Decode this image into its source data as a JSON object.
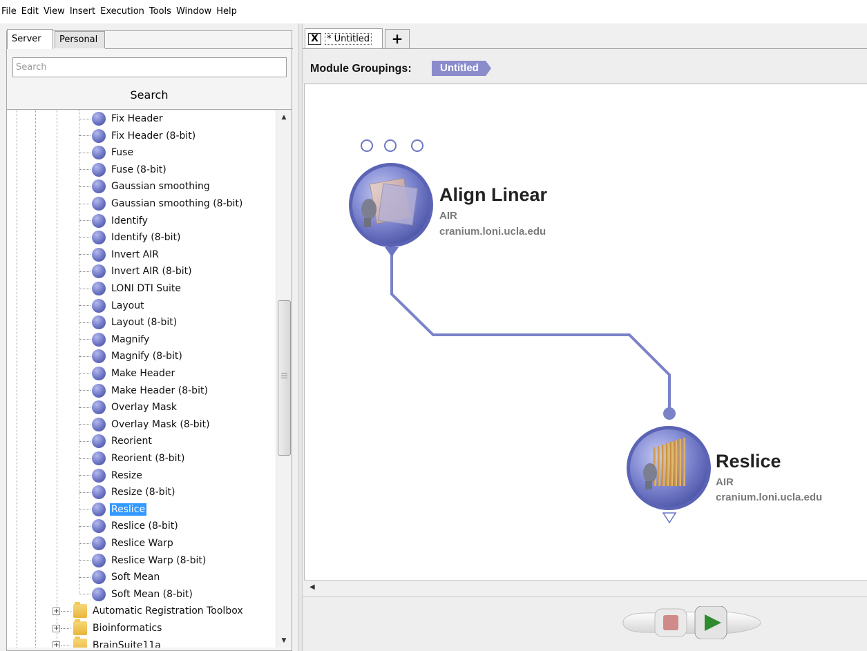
{
  "menu": [
    "File",
    "Edit",
    "View",
    "Insert",
    "Execution",
    "Tools",
    "Window",
    "Help"
  ],
  "left_tabs": {
    "server": "Server",
    "personal": "Personal"
  },
  "search": {
    "placeholder": "Search",
    "button": "Search"
  },
  "tree_items": [
    "Fix Header",
    "Fix Header (8-bit)",
    "Fuse",
    "Fuse (8-bit)",
    "Gaussian smoothing",
    "Gaussian smoothing (8-bit)",
    "Identify",
    "Identify (8-bit)",
    "Invert AIR",
    "Invert AIR (8-bit)",
    "LONI DTI Suite",
    "Layout",
    "Layout (8-bit)",
    "Magnify",
    "Magnify (8-bit)",
    "Make Header",
    "Make Header (8-bit)",
    "Overlay Mask",
    "Overlay Mask (8-bit)",
    "Reorient",
    "Reorient (8-bit)",
    "Resize",
    "Resize (8-bit)",
    "Reslice",
    "Reslice (8-bit)",
    "Reslice Warp",
    "Reslice Warp (8-bit)",
    "Soft Mean",
    "Soft Mean (8-bit)"
  ],
  "selected_item": "Reslice",
  "tree_folders": [
    "Automatic Registration Toolbox",
    "Bioinformatics",
    "BrainSuite11a"
  ],
  "document_tab": {
    "label": "* Untitled",
    "close": "X",
    "add": "+"
  },
  "groupings": {
    "label": "Module Groupings:",
    "current": "Untitled"
  },
  "modules": [
    {
      "title": "Align Linear",
      "package": "AIR",
      "server": "cranium.loni.ucla.edu"
    },
    {
      "title": "Reslice",
      "package": "AIR",
      "server": "cranium.loni.ucla.edu"
    }
  ],
  "colors": {
    "accent": "#8a8ccc",
    "selection": "#3399ff",
    "connector": "#7a82c8",
    "node": "#6c75c4"
  }
}
